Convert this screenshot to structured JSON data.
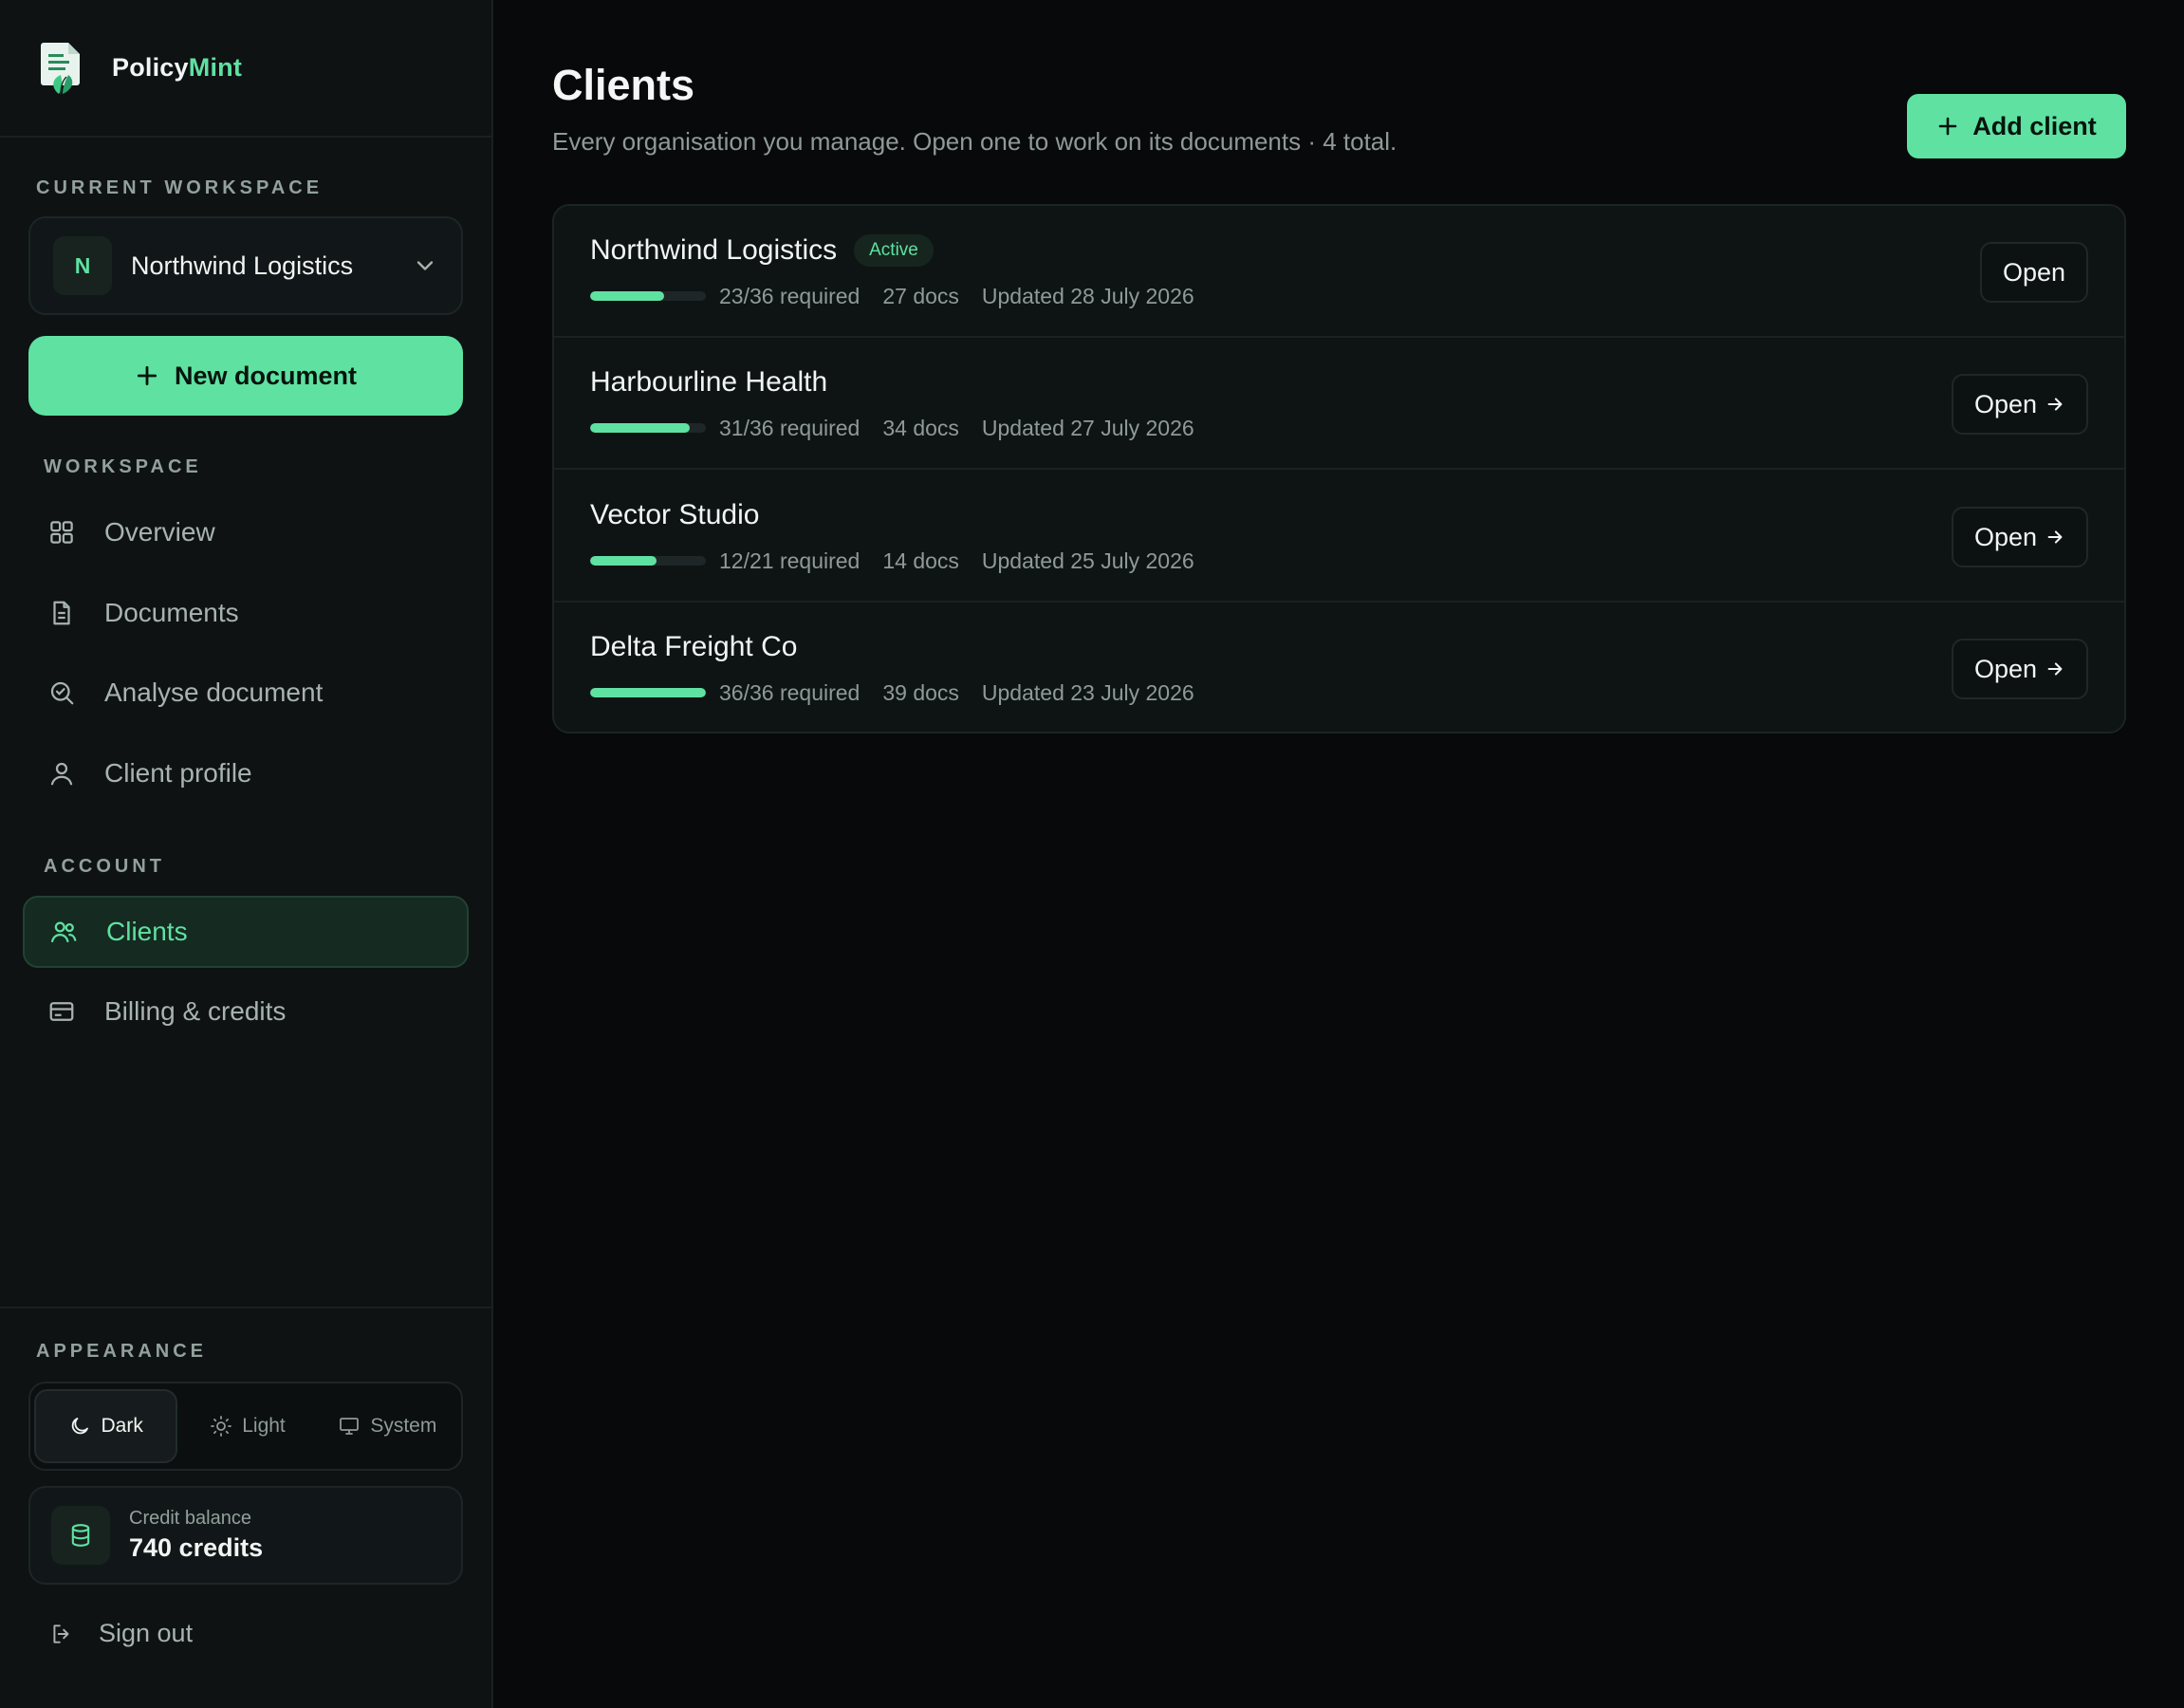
{
  "brand": {
    "name_prefix": "Policy",
    "name_accent": "Mint"
  },
  "sidebar": {
    "current_workspace_label": "CURRENT WORKSPACE",
    "workspace": {
      "initial": "N",
      "name": "Northwind Logistics"
    },
    "new_document_label": "New document",
    "workspace_section_label": "WORKSPACE",
    "workspace_items": [
      {
        "label": "Overview",
        "icon": "grid-icon"
      },
      {
        "label": "Documents",
        "icon": "document-icon"
      },
      {
        "label": "Analyse document",
        "icon": "analyse-icon"
      },
      {
        "label": "Client profile",
        "icon": "user-icon"
      }
    ],
    "account_section_label": "ACCOUNT",
    "account_items": [
      {
        "label": "Clients",
        "icon": "users-icon",
        "active": true
      },
      {
        "label": "Billing & credits",
        "icon": "card-icon",
        "active": false
      }
    ],
    "appearance_label": "APPEARANCE",
    "themes": [
      {
        "label": "Dark",
        "icon": "moon-icon",
        "active": true
      },
      {
        "label": "Light",
        "icon": "sun-icon",
        "active": false
      },
      {
        "label": "System",
        "icon": "monitor-icon",
        "active": false
      }
    ],
    "credits": {
      "label": "Credit balance",
      "value": "740 credits"
    },
    "sign_out_label": "Sign out"
  },
  "main": {
    "title": "Clients",
    "subtitle": "Every organisation you manage. Open one to work on its documents · 4 total.",
    "add_client_label": "Add client",
    "clients": [
      {
        "name": "Northwind Logistics",
        "badge": "Active",
        "progress": 0.64,
        "required": "23/36 required",
        "docs": "27 docs",
        "updated": "Updated 28 July 2026",
        "open_label": "Open",
        "show_arrow": false
      },
      {
        "name": "Harbourline Health",
        "badge": "",
        "progress": 0.86,
        "required": "31/36 required",
        "docs": "34 docs",
        "updated": "Updated 27 July 2026",
        "open_label": "Open",
        "show_arrow": true
      },
      {
        "name": "Vector Studio",
        "badge": "",
        "progress": 0.57,
        "required": "12/21 required",
        "docs": "14 docs",
        "updated": "Updated 25 July 2026",
        "open_label": "Open",
        "show_arrow": true
      },
      {
        "name": "Delta Freight Co",
        "badge": "",
        "progress": 1.0,
        "required": "36/36 required",
        "docs": "39 docs",
        "updated": "Updated 23 July 2026",
        "open_label": "Open",
        "show_arrow": true
      }
    ]
  },
  "colors": {
    "accent": "#5fe1a2",
    "background": "#07090a",
    "sidebar": "#0e1213"
  }
}
